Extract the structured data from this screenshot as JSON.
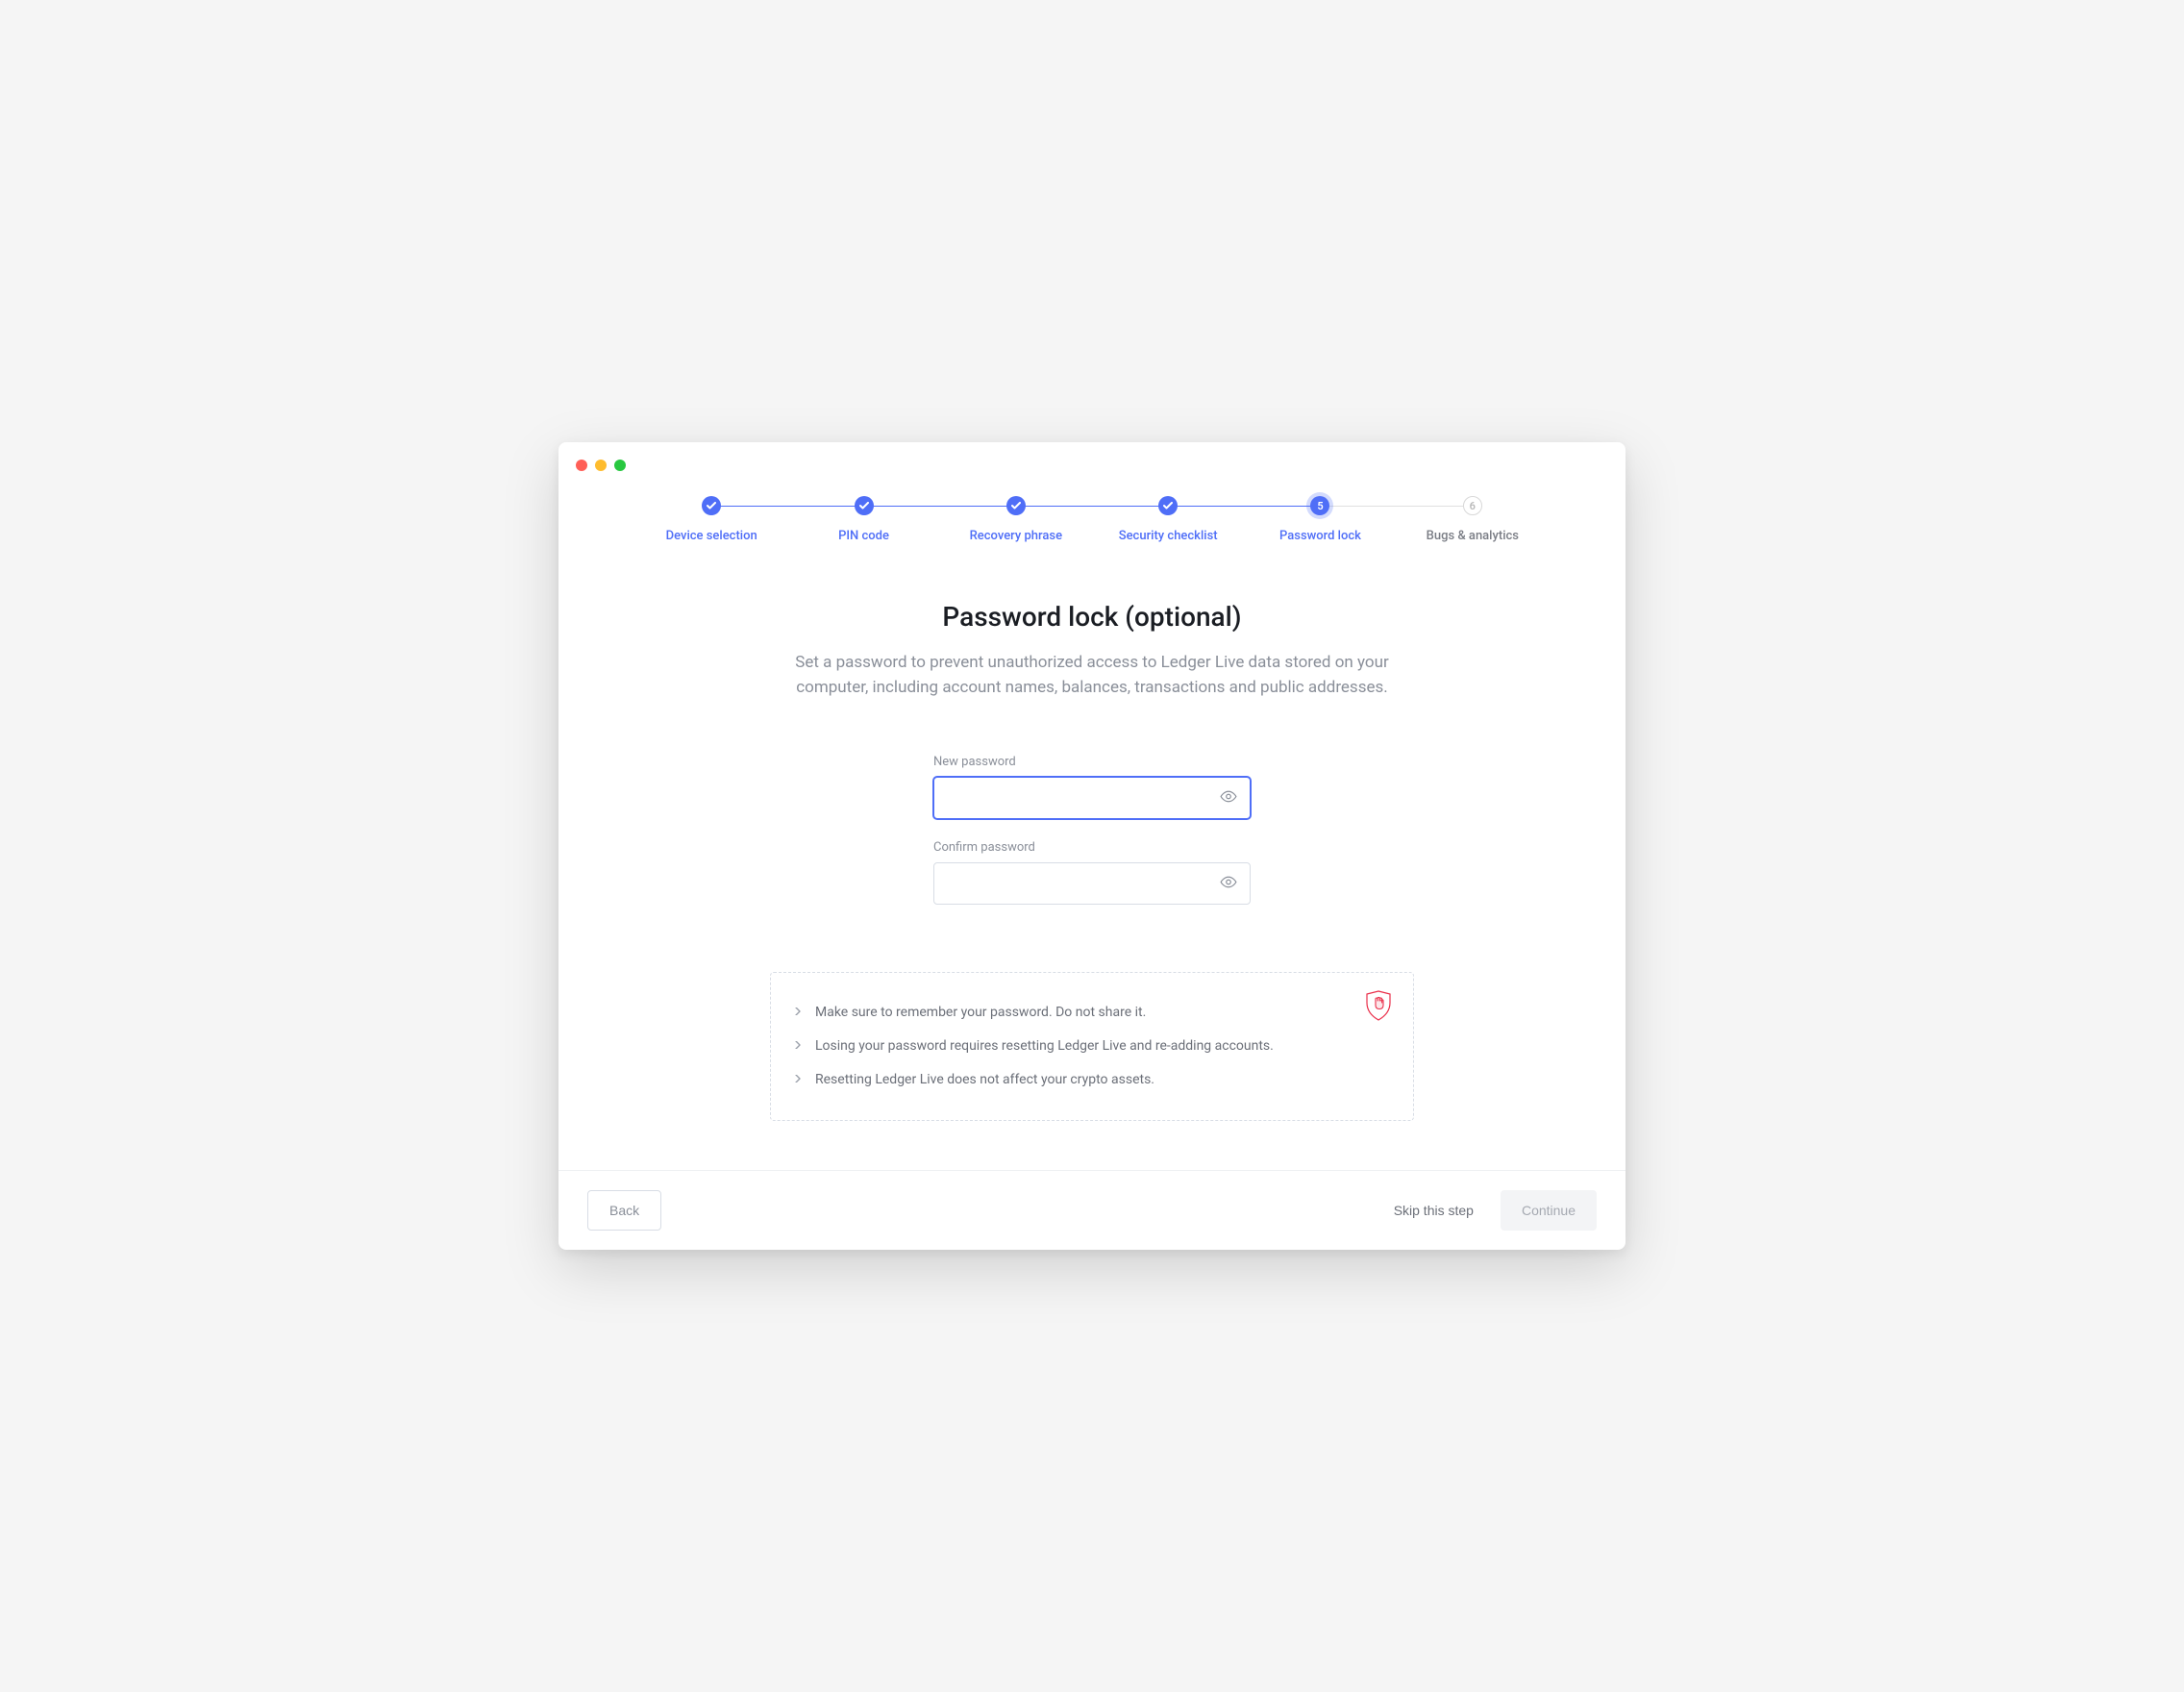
{
  "stepper": {
    "steps": [
      {
        "label": "Device selection",
        "state": "done"
      },
      {
        "label": "PIN code",
        "state": "done"
      },
      {
        "label": "Recovery phrase",
        "state": "done"
      },
      {
        "label": "Security checklist",
        "state": "done"
      },
      {
        "label": "Password lock",
        "state": "current",
        "number": "5"
      },
      {
        "label": "Bugs & analytics",
        "state": "upcoming",
        "number": "6"
      }
    ]
  },
  "main": {
    "title": "Password lock (optional)",
    "subtitle": "Set a password to prevent unauthorized access to Ledger Live data stored on your computer, including account names, balances, transactions and public addresses."
  },
  "form": {
    "new_password_label": "New password",
    "new_password_value": "",
    "confirm_password_label": "Confirm password",
    "confirm_password_value": ""
  },
  "info": {
    "items": [
      "Make sure to remember your password. Do not share it.",
      "Losing your password requires resetting Ledger Live and re-adding accounts.",
      "Resetting Ledger Live does not affect your crypto assets."
    ]
  },
  "footer": {
    "back_label": "Back",
    "skip_label": "Skip this step",
    "continue_label": "Continue"
  }
}
